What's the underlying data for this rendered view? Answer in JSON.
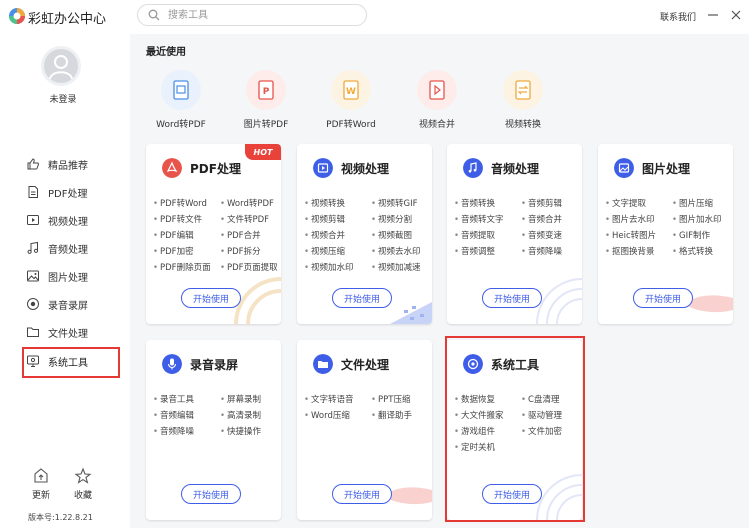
{
  "app": {
    "title": "彩虹办公中心"
  },
  "search": {
    "placeholder": "搜索工具"
  },
  "header": {
    "contact": "联系我们"
  },
  "user": {
    "status": "未登录"
  },
  "sidebar": {
    "items": [
      {
        "label": "精品推荐",
        "icon": "thumbs-up-icon"
      },
      {
        "label": "PDF处理",
        "icon": "pdf-icon"
      },
      {
        "label": "视频处理",
        "icon": "video-icon"
      },
      {
        "label": "音频处理",
        "icon": "music-icon"
      },
      {
        "label": "图片处理",
        "icon": "image-icon"
      },
      {
        "label": "录音录屏",
        "icon": "record-icon"
      },
      {
        "label": "文件处理",
        "icon": "folder-icon"
      },
      {
        "label": "系统工具",
        "icon": "system-icon"
      }
    ],
    "update_label": "更新",
    "favorite_label": "收藏",
    "version": "版本号:1.22.8.21"
  },
  "recent": {
    "title": "最近使用",
    "items": [
      {
        "label": "Word转PDF",
        "color": "#4a8fe7"
      },
      {
        "label": "图片转PDF",
        "color": "#e8534a"
      },
      {
        "label": "PDF转Word",
        "color": "#f0a93a"
      },
      {
        "label": "视频合并",
        "color": "#e8534a"
      },
      {
        "label": "视频转换",
        "color": "#f0a93a"
      }
    ]
  },
  "cards": [
    {
      "title": "PDF处理",
      "hot": "HOT",
      "tools": [
        "PDF转Word",
        "Word转PDF",
        "PDF转文件",
        "文件转PDF",
        "PDF编辑",
        "PDF合并",
        "PDF加密",
        "PDF拆分",
        "PDF删除页面",
        "PDF页面提取"
      ],
      "button": "开始使用"
    },
    {
      "title": "视频处理",
      "tools": [
        "视频转换",
        "视频转GIF",
        "视频剪辑",
        "视频分割",
        "视频合并",
        "视频截图",
        "视频压缩",
        "视频去水印",
        "视频加水印",
        "视频加减速"
      ],
      "button": "开始使用"
    },
    {
      "title": "音频处理",
      "tools": [
        "音频转换",
        "音频剪辑",
        "音频转文字",
        "音频合并",
        "音频提取",
        "音频变速",
        "音频调整",
        "音频降噪"
      ],
      "button": "开始使用"
    },
    {
      "title": "图片处理",
      "tools": [
        "文字提取",
        "图片压缩",
        "图片去水印",
        "图片加水印",
        "Heic转图片",
        "GIF制作",
        "抠图换背景",
        "格式转换"
      ],
      "button": "开始使用"
    },
    {
      "title": "录音录屏",
      "tools": [
        "录音工具",
        "屏幕录制",
        "音频编辑",
        "高清录制",
        "音频降噪",
        "快捷操作"
      ],
      "button": "开始使用"
    },
    {
      "title": "文件处理",
      "tools": [
        "文字转语音",
        "PPT压缩",
        "Word压缩",
        "翻译助手"
      ],
      "button": "开始使用"
    },
    {
      "title": "系统工具",
      "tools": [
        "数据恢复",
        "C盘清理",
        "大文件搬家",
        "驱动管理",
        "游戏组件",
        "文件加密",
        "定时关机"
      ],
      "button": "开始使用"
    }
  ],
  "colors": {
    "accent": "#3f5ee8",
    "highlight": "#e53935",
    "hot": "#e8423b"
  }
}
